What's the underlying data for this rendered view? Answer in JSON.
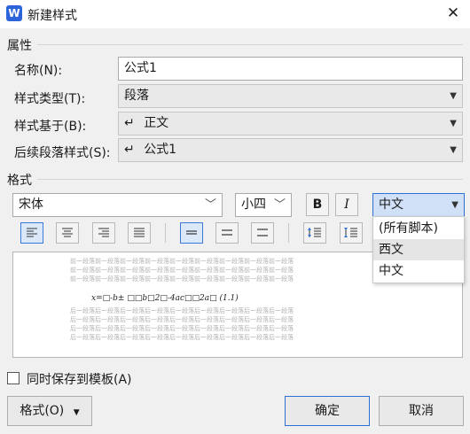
{
  "window": {
    "title": "新建样式",
    "app_icon_letter": "W",
    "close_glyph": "✕"
  },
  "properties": {
    "heading": "属性",
    "name_label": "名称(N):",
    "name_value": "公式1",
    "style_type_label": "样式类型(T):",
    "style_type_value": "段落",
    "based_on_label": "样式基于(B):",
    "based_on_value": "正文",
    "following_label": "后续段落样式(S):",
    "following_value": "公式1",
    "paragraph_glyph": "↵"
  },
  "format": {
    "heading": "格式",
    "font_value": "宋体",
    "size_value": "小四",
    "bold_label": "B",
    "italic_label": "I",
    "script_value": "中文",
    "script_options": [
      "(所有脚本)",
      "西文",
      "中文"
    ],
    "highlighted_option_index": 1
  },
  "preview": {
    "prev_para": "前一段落前一段落前一段落前一段落前一段落前一段落前一段落前一段落前一段落",
    "formula": "x=□-b± □□b□2□-4ac□□2a□ (1.1)",
    "next_para": "后一段落后一段落后一段落后一段落后一段落后一段落后一段落后一段落后一段落"
  },
  "footer": {
    "save_to_template_label": "同时保存到模板(A)",
    "format_menu_label": "格式(O)",
    "ok_label": "确定",
    "cancel_label": "取消"
  },
  "colors": {
    "accent": "#2f6fd6",
    "app_icon": "#2b63d9",
    "dialog_bg": "#f0f0f0"
  }
}
